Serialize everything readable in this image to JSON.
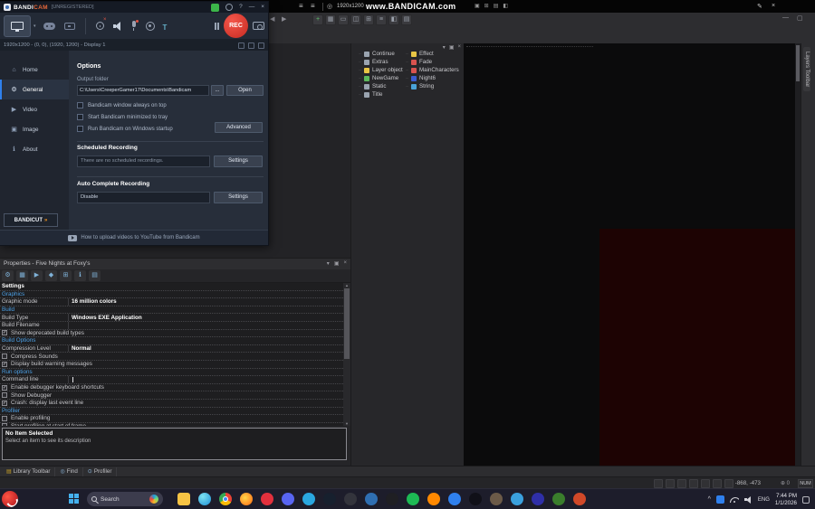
{
  "watermark_bar": {
    "hamburger": "≡",
    "target_glyph": "◎",
    "resolution": "1920x1200",
    "watermark": "www.BANDICAM.com",
    "right_icons": [
      "▣",
      "⊞",
      "▤",
      "◧"
    ],
    "pencil": "✎",
    "close": "×"
  },
  "bandicam": {
    "logo_bandi": "BANDI",
    "logo_cam": "CAM",
    "unregistered": "[UNREGISTERED]",
    "titlebar": {
      "help": "?",
      "minimize": "—",
      "close": "×"
    },
    "rec_label": "REC",
    "info_text": "1920x1200 - (0, 0), (1920, 1200) - Display 1",
    "sidebar": [
      {
        "label": "Home",
        "icon": "home",
        "glyph": "⌂",
        "active": false
      },
      {
        "label": "General",
        "icon": "gear",
        "glyph": "⚙",
        "active": true
      },
      {
        "label": "Video",
        "icon": "video",
        "glyph": "▶",
        "active": false
      },
      {
        "label": "Image",
        "icon": "image",
        "glyph": "▣",
        "active": false
      },
      {
        "label": "About",
        "icon": "info",
        "glyph": "ℹ",
        "active": false
      }
    ],
    "options": {
      "heading": "Options",
      "output_folder_label": "Output folder",
      "output_folder_value": "C:\\Users\\CreeperGamer17\\Documents\\Bandicam",
      "browse_label": "...",
      "open_label": "Open",
      "checkboxes": [
        {
          "label": "Bandicam window always on top",
          "checked": false
        },
        {
          "label": "Start Bandicam minimized to tray",
          "checked": false
        },
        {
          "label": "Run Bandicam on Windows startup",
          "checked": false
        }
      ],
      "advanced_label": "Advanced",
      "scheduled_heading": "Scheduled Recording",
      "scheduled_value": "There are no scheduled recordings.",
      "settings_label": "Settings",
      "autocomplete_heading": "Auto Complete Recording",
      "autocomplete_value": "Disable",
      "bandicut_text": "BANDICUT",
      "bandicut_arrow": "»",
      "footer_text": "How to upload videos to YouTube from Bandicam"
    }
  },
  "fusion": {
    "nav_back": "◀",
    "nav_forward": "▶",
    "window_controls": {
      "minimize": "—",
      "maximize": "▢"
    },
    "toolbar_icons": [
      {
        "name": "add",
        "glyph": "+",
        "color": "#5fc06a"
      },
      {
        "name": "grid",
        "glyph": "▦"
      },
      {
        "name": "frame",
        "glyph": "▭"
      },
      {
        "name": "split",
        "glyph": "◫"
      },
      {
        "name": "table",
        "glyph": "⊞"
      },
      {
        "name": "list",
        "glyph": "≡"
      },
      {
        "name": "panel",
        "glyph": "◧"
      },
      {
        "name": "rows",
        "glyph": "▤"
      }
    ],
    "workspace": {
      "header_icons": [
        "▾",
        "▣",
        "×"
      ],
      "left_items": [
        {
          "label": "Continue",
          "color": "#9aa4b0"
        },
        {
          "label": "Extras",
          "color": "#9aa4b0"
        },
        {
          "label": "Layer object",
          "color": "#e8c545"
        },
        {
          "label": "NewGame",
          "color": "#5cb85c"
        },
        {
          "label": "Static",
          "color": "#9aa4b0"
        },
        {
          "label": "Title",
          "color": "#9aa4b0"
        }
      ],
      "right_items": [
        {
          "label": "Effect",
          "color": "#e8c545"
        },
        {
          "label": "Fade",
          "color": "#d9534f"
        },
        {
          "label": "MainCharacters",
          "color": "#d9534f"
        },
        {
          "label": "Night6",
          "color": "#3b5bd0"
        },
        {
          "label": "String",
          "color": "#4aa3d9"
        }
      ]
    },
    "properties": {
      "title": "Properties - Five Nights at Foxy's",
      "header_icons": [
        "▾",
        "▣",
        "×"
      ],
      "toolbar_icons": [
        {
          "name": "settings",
          "glyph": "⚙"
        },
        {
          "name": "window",
          "glyph": "▦"
        },
        {
          "name": "runtime",
          "glyph": "▶"
        },
        {
          "name": "values",
          "glyph": "◆"
        },
        {
          "name": "events",
          "glyph": "⊞"
        },
        {
          "name": "about",
          "glyph": "ℹ"
        },
        {
          "name": "blocks",
          "glyph": "▤"
        }
      ],
      "rows": [
        {
          "type": "header",
          "label": "Settings"
        },
        {
          "type": "category",
          "label": "Graphics"
        },
        {
          "type": "prop",
          "label": "Graphic mode",
          "value": "16 million colors"
        },
        {
          "type": "category",
          "label": "Build"
        },
        {
          "type": "prop",
          "label": "Build Type",
          "value": "Windows EXE Application"
        },
        {
          "type": "prop",
          "label": "Build Filename",
          "value": ""
        },
        {
          "type": "checkbox",
          "label": "Show deprecated build types",
          "checked": true
        },
        {
          "type": "category",
          "label": "Build Options"
        },
        {
          "type": "prop",
          "label": "Compression Level",
          "value": "Normal"
        },
        {
          "type": "checkbox",
          "label": "Compress Sounds",
          "checked": false
        },
        {
          "type": "checkbox",
          "label": "Display build warning messages",
          "checked": true
        },
        {
          "type": "category",
          "label": "Run options"
        },
        {
          "type": "prop",
          "label": "Command line",
          "value": "",
          "caret": true
        },
        {
          "type": "checkbox",
          "label": "Enable debugger keyboard shortcuts",
          "checked": true
        },
        {
          "type": "checkbox",
          "label": "Show Debugger",
          "checked": false
        },
        {
          "type": "checkbox",
          "label": "Crash: display last event line",
          "checked": true
        },
        {
          "type": "category",
          "label": "Profiler"
        },
        {
          "type": "checkbox",
          "label": "Enable profiling",
          "checked": false
        },
        {
          "type": "checkbox",
          "label": "Start profiling at start of frame",
          "checked": false
        }
      ],
      "description_title": "No Item Selected",
      "description_text": "Select an item to see its description"
    },
    "bottom_tabs": [
      {
        "label": "Library Toolbar",
        "glyph": "▤",
        "color": "#c9a227"
      },
      {
        "label": "Find",
        "glyph": "◎",
        "color": "#8ab4d8"
      },
      {
        "label": "Profiler",
        "glyph": "⊙",
        "color": "#8ab4d8"
      }
    ],
    "status": {
      "coords": "-868, -473",
      "zoom_glyph": "⊕",
      "zoom_value": "0",
      "num": "NUM"
    },
    "layers_tab": "Layers Toolbar"
  },
  "taskbar": {
    "search_label": "Search",
    "apps": [
      {
        "name": "file-explorer",
        "bg": "#f6c344",
        "shape": "square"
      },
      {
        "name": "edge",
        "bg": "radial-gradient(circle at 35% 30%, #7ee3f2, #1d8fd6)"
      },
      {
        "name": "chrome",
        "bg": "conic-gradient(#ea4335 0 33%, #fbbc05 33% 66%, #34a853 66% 100%)",
        "dot": "#4285f4"
      },
      {
        "name": "firefox",
        "bg": "radial-gradient(circle at 40% 40%, #ffd54a, #ff6611)"
      },
      {
        "name": "opera",
        "bg": "#e2303d"
      },
      {
        "name": "discord",
        "bg": "#5865f2"
      },
      {
        "name": "telegram",
        "bg": "#2aa7e0"
      },
      {
        "name": "steam",
        "bg": "#17202e"
      },
      {
        "name": "epic-games",
        "bg": "#33343c"
      },
      {
        "name": "bandicam",
        "bg": "#2f6fb2"
      },
      {
        "name": "obs-studio",
        "bg": "#1f1f23"
      },
      {
        "name": "spotify",
        "bg": "#1db954"
      },
      {
        "name": "vlc",
        "bg": "#ff8800"
      },
      {
        "name": "vs-code",
        "bg": "#2f80ed"
      },
      {
        "name": "tiktok",
        "bg": "#101018"
      },
      {
        "name": "gimp",
        "bg": "#6b5a48"
      },
      {
        "name": "paint",
        "bg": "#3aa0dd"
      },
      {
        "name": "audacity",
        "bg": "#2f2fa8"
      },
      {
        "name": "minecraft",
        "bg": "#3a7d2c"
      },
      {
        "name": "fusion",
        "bg": "#d04828"
      }
    ],
    "tray": {
      "chevron": "^",
      "lang": "ENG",
      "time": "7:44 PM",
      "date": "1/1/2026"
    }
  }
}
